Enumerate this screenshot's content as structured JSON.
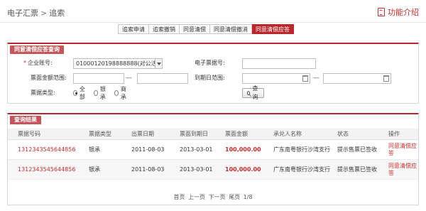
{
  "header": {
    "crumb_root": "电子汇票",
    "crumb_sep": ">",
    "crumb_current": "追索",
    "func_intro": "功能介绍"
  },
  "tabs": [
    {
      "label": "追索申请",
      "active": false
    },
    {
      "label": "追索撤销",
      "active": false
    },
    {
      "label": "同意清偿",
      "active": false
    },
    {
      "label": "同意清偿撤消",
      "active": false
    },
    {
      "label": "同意清偿应答",
      "active": true
    }
  ],
  "query": {
    "title": "同意清偿应答查询",
    "account_label": "企业账号:",
    "account_required": "*",
    "account_value": "01000120198888888(对公活期)/xxx公",
    "ebill_no_label": "电子票据号:",
    "ebill_no_value": "",
    "amount_range_label": "票面金额范围:",
    "amount_from": "",
    "amount_to": "",
    "due_range_label": "到期日范围:",
    "due_from": "",
    "due_to": "",
    "dash": "—",
    "type_label": "票据类型:",
    "type_options": [
      {
        "label": "全部",
        "checked": true
      },
      {
        "label": "银承",
        "checked": false
      },
      {
        "label": "商承",
        "checked": false
      }
    ],
    "query_button": "查询"
  },
  "result": {
    "title": "查询结果",
    "columns": [
      "票据号码",
      "票据类型",
      "出票日期",
      "票面到期日",
      "票面金额",
      "承兑人名称",
      "状态",
      "操作"
    ],
    "rows": [
      {
        "bill_no": "1312343545644856",
        "type": "银承",
        "issue_date": "2011-08-03",
        "due_date": "2013-03-01",
        "amount": "100,000.00",
        "acceptor": "广东南粤银行沙湾支行",
        "status": "提示售票已签收",
        "action": "同意清偿应答"
      },
      {
        "bill_no": "1312343545644856",
        "type": "银承",
        "issue_date": "2011-08-03",
        "due_date": "2013-03-01",
        "amount": "100,000.00",
        "acceptor": "广东南粤银行沙湾支行",
        "status": "提示售票已签收",
        "action": "同意清偿应答"
      }
    ],
    "pager": {
      "first": "首页",
      "prev": "上一页",
      "next": "下一页",
      "last": "尾页",
      "page": "1/8"
    }
  },
  "colors": {
    "accent": "#b8272c",
    "link_red": "#c62d2d"
  }
}
